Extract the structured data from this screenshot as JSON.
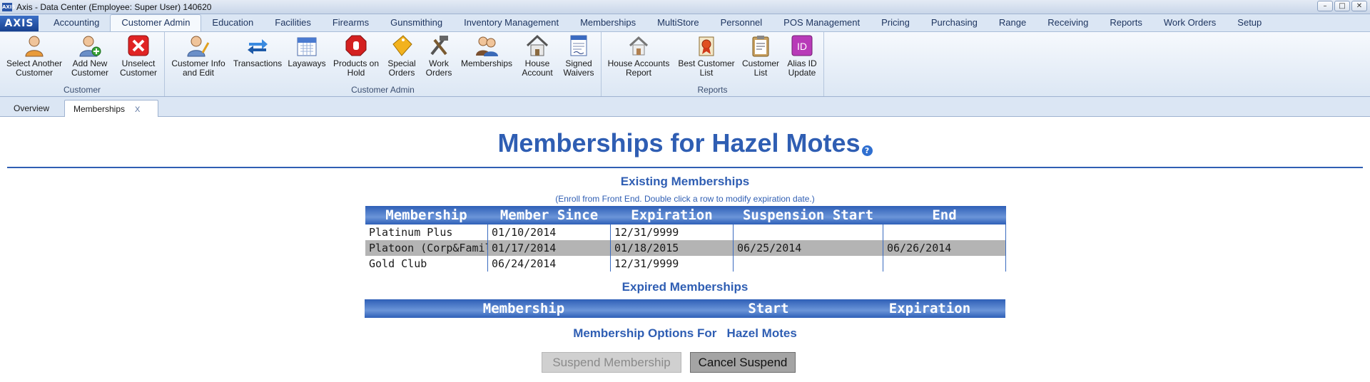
{
  "window": {
    "title": "Axis - Data Center  (Employee: Super User) 140620",
    "app_icon_label": "AXIS"
  },
  "ribbon": {
    "logo": "AXIS",
    "tabs": [
      {
        "label": "Accounting"
      },
      {
        "label": "Customer Admin",
        "active": true
      },
      {
        "label": "Education"
      },
      {
        "label": "Facilities"
      },
      {
        "label": "Firearms"
      },
      {
        "label": "Gunsmithing"
      },
      {
        "label": "Inventory Management"
      },
      {
        "label": "Memberships"
      },
      {
        "label": "MultiStore"
      },
      {
        "label": "Personnel"
      },
      {
        "label": "POS Management"
      },
      {
        "label": "Pricing"
      },
      {
        "label": "Purchasing"
      },
      {
        "label": "Range"
      },
      {
        "label": "Receiving"
      },
      {
        "label": "Reports"
      },
      {
        "label": "Work Orders"
      },
      {
        "label": "Setup"
      }
    ],
    "groups": [
      {
        "label": "Customer",
        "buttons": [
          {
            "label": "Select Another\nCustomer",
            "icon": "person-icon"
          },
          {
            "label": "Add New\nCustomer",
            "icon": "add-person-icon"
          },
          {
            "label": "Unselect\nCustomer",
            "icon": "red-x-icon"
          }
        ]
      },
      {
        "label": "Customer Admin",
        "buttons": [
          {
            "label": "Customer Info\nand Edit",
            "icon": "person-edit-icon"
          },
          {
            "label": "Transactions",
            "icon": "transfer-arrows-icon"
          },
          {
            "label": "Layaways",
            "icon": "calendar-icon"
          },
          {
            "label": "Products on\nHold",
            "icon": "stop-hand-icon"
          },
          {
            "label": "Special\nOrders",
            "icon": "special-tag-icon"
          },
          {
            "label": "Work\nOrders",
            "icon": "tools-icon"
          },
          {
            "label": "Memberships",
            "icon": "people-icon"
          },
          {
            "label": "House\nAccount",
            "icon": "house-icon"
          },
          {
            "label": "Signed\nWaivers",
            "icon": "waiver-document-icon"
          }
        ]
      },
      {
        "label": "Reports",
        "buttons": [
          {
            "label": "House Accounts\nReport",
            "icon": "house-report-icon"
          },
          {
            "label": "Best Customer\nList",
            "icon": "ribbon-award-icon"
          },
          {
            "label": "Customer\nList",
            "icon": "clipboard-icon"
          },
          {
            "label": "Alias ID\nUpdate",
            "icon": "id-badge-icon"
          }
        ]
      }
    ]
  },
  "doc_tabs": {
    "overview": "Overview",
    "memberships": "Memberships",
    "close": "X"
  },
  "page": {
    "title": "Memberships for Hazel Motes",
    "help": "?"
  },
  "existing": {
    "heading": "Existing Memberships",
    "note": "(Enroll from Front End. Double click a row to modify expiration date.)",
    "columns": [
      "Membership",
      "Member Since",
      "Expiration",
      "Suspension Start",
      "End"
    ],
    "rows": [
      {
        "membership": "Platinum Plus",
        "since": "01/10/2014",
        "expiration": "12/31/9999",
        "susp_start": "",
        "end": "",
        "selected": false
      },
      {
        "membership": "Platoon (Corp&Family)",
        "since": "01/17/2014",
        "expiration": "01/18/2015",
        "susp_start": "06/25/2014",
        "end": "06/26/2014",
        "selected": true
      },
      {
        "membership": "Gold Club",
        "since": "06/24/2014",
        "expiration": "12/31/9999",
        "susp_start": "",
        "end": "",
        "selected": false
      }
    ]
  },
  "expired": {
    "heading": "Expired Memberships",
    "columns": [
      "Membership",
      "Start",
      "Expiration"
    ],
    "rows": []
  },
  "options": {
    "heading_prefix": "Membership Options For",
    "customer": "Hazel Motes",
    "suspend_label": "Suspend Membership",
    "suspend_enabled": false,
    "cancel_label": "Cancel Suspend"
  },
  "colors": {
    "accent": "#2f5eb3",
    "selected_row": "#b4b4b4",
    "header_bg": "#3e6ec2"
  }
}
